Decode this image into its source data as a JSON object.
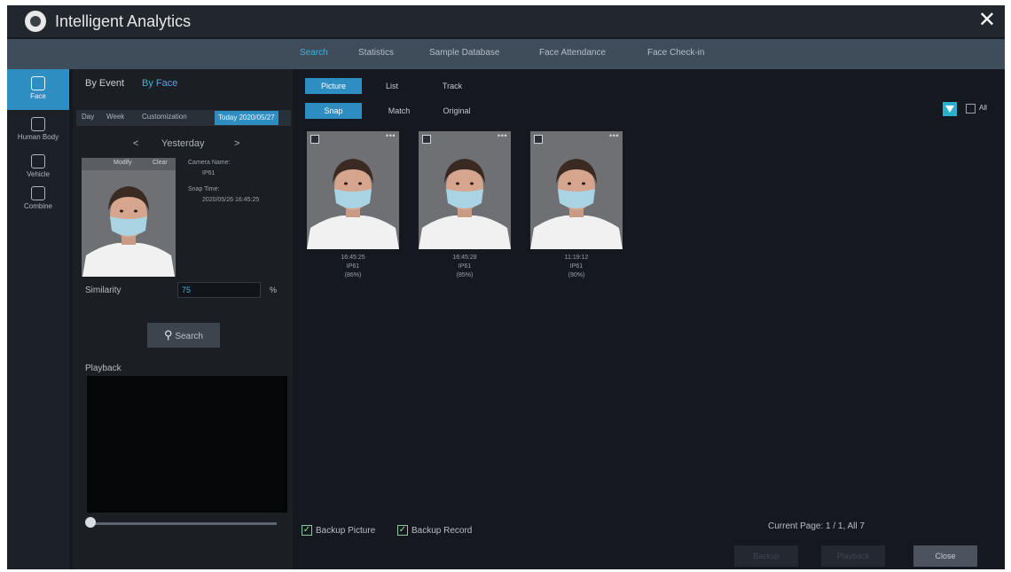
{
  "window": {
    "title": "Intelligent Analytics",
    "close_icon": "close-icon"
  },
  "top_tabs": [
    {
      "label": "Search",
      "active": true
    },
    {
      "label": "Statistics",
      "active": false
    },
    {
      "label": "Sample Database",
      "active": false
    },
    {
      "label": "Face Attendance",
      "active": false
    },
    {
      "label": "Face Check-in",
      "active": false
    }
  ],
  "left_nav": [
    {
      "label": "Face",
      "icon": "face-icon",
      "active": true
    },
    {
      "label": "Human Body",
      "icon": "human-body-icon",
      "active": false
    },
    {
      "label": "Vehicle",
      "icon": "vehicle-icon",
      "active": false
    },
    {
      "label": "Combine",
      "icon": "combine-icon",
      "active": false
    }
  ],
  "side": {
    "by_event": "By Event",
    "by_face": "By Face",
    "filters": [
      "Day",
      "Week",
      "Customization"
    ],
    "date_active": "Today 2020/05/27",
    "prev": "<",
    "day": "Yesterday",
    "next": ">",
    "face_tabs": [
      "Modify",
      "Clear"
    ],
    "camera_label": "Camera Name:",
    "camera_value": "IP61",
    "snap_label": "Snap Time:",
    "snap_value": "2020/05/26 16:45:25",
    "similarity_label": "Similarity",
    "similarity_value": "75",
    "similarity_unit": "%",
    "search_label": "Search",
    "playback_label": "Playback",
    "playback_position": 0
  },
  "main": {
    "view_tabs": [
      "Picture",
      "List",
      "Track"
    ],
    "image_tabs": [
      "Snap",
      "Match",
      "Original"
    ],
    "all_label": "All",
    "results": [
      {
        "time": "16:45:25",
        "camera": "IP61",
        "score": "(86%)"
      },
      {
        "time": "16:45:28",
        "camera": "IP61",
        "score": "(85%)"
      },
      {
        "time": "11:19:12",
        "camera": "IP61",
        "score": "(90%)"
      }
    ],
    "backup_picture": "Backup Picture",
    "backup_record": "Backup Record",
    "page_info": "Current Page: 1 / 1, All 7",
    "btn_backup": "Backup",
    "btn_playback": "Playback",
    "btn_close": "Close",
    "colors": {
      "accent": "#2f8ec1",
      "background": "#15191f",
      "tab_bar": "#3f4c5a"
    }
  }
}
